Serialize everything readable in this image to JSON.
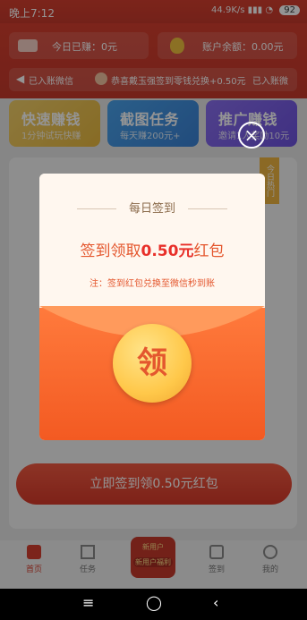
{
  "status": {
    "time": "晚上7:12",
    "speed": "44.9K/s",
    "battery": "92"
  },
  "top": {
    "today_earned": "今日已赚：0元",
    "balance": "账户余额：0.00元"
  },
  "ticker": {
    "left": "已入账微信",
    "main": "恭喜戴玉强签到零钱兑换+0.50元",
    "right": "已入账微"
  },
  "cards": [
    {
      "title": "快速赚钱",
      "subtitle": "1分钟试玩快赚"
    },
    {
      "title": "截图任务",
      "subtitle": "每天赚200元+"
    },
    {
      "title": "推广赚钱",
      "subtitle": "邀请1人奖励10元"
    }
  ],
  "side_tag": "今日热门",
  "modal": {
    "title": "每日签到",
    "headline_prefix": "签到领取",
    "headline_amount": "0.50元",
    "headline_suffix": "红包",
    "note": "注：签到红包兑换至微信秒到账",
    "coin_text": "领"
  },
  "cta_label": "立即签到领0.50元红包",
  "bottom_nav": [
    {
      "label": "首页"
    },
    {
      "label": "任务"
    },
    {
      "label": "新用户",
      "sub": "新用户福利"
    },
    {
      "label": "签到"
    },
    {
      "label": "我的"
    }
  ],
  "colors": {
    "brand_red": "#d63f2f",
    "orange": "#f35a22",
    "coin_yellow": "#ffc84a"
  }
}
